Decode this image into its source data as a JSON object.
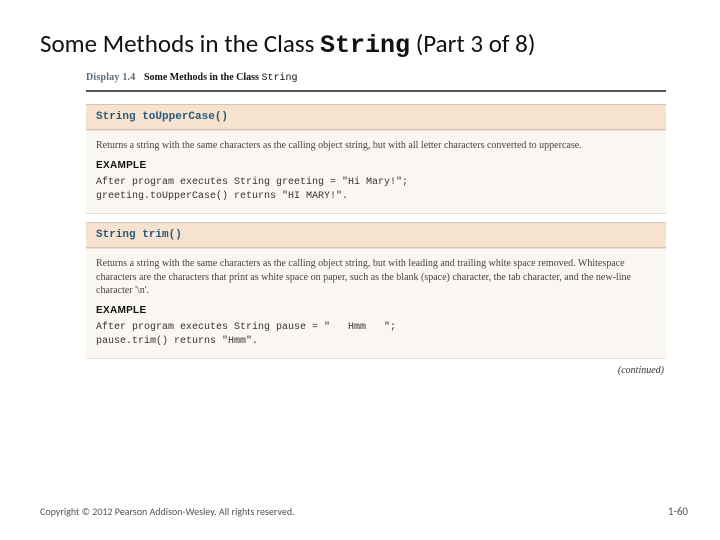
{
  "title": {
    "prefix": "Some Methods in the Class ",
    "classname": "String",
    "suffix": " (Part 3 of 8)"
  },
  "display": {
    "label": "Display 1.4",
    "title_prefix": "Some Methods in the Class ",
    "title_mono": "String"
  },
  "methods": [
    {
      "signature": "String toUpperCase()",
      "description": "Returns a string with the same characters as the calling object string, but with all letter characters converted to uppercase.",
      "example_label": "EXAMPLE",
      "example_lines": [
        "After program executes String greeting = \"Hi Mary!\";",
        "greeting.toUpperCase() returns \"HI MARY!\"."
      ]
    },
    {
      "signature": "String trim()",
      "description": "Returns a string with the same characters as the calling object string, but with leading and trailing white space removed. Whitespace characters are the characters that print as white space on paper, such as the blank (space) character, the tab character, and the new-line character '\\n'.",
      "example_label": "EXAMPLE",
      "example_lines": [
        "After program executes String pause = \"   Hmm   \";",
        "pause.trim() returns \"Hmm\"."
      ]
    }
  ],
  "continued": "(continued)",
  "copyright": "Copyright © 2012 Pearson Addison-Wesley. All rights reserved.",
  "pagenum": "1-60"
}
